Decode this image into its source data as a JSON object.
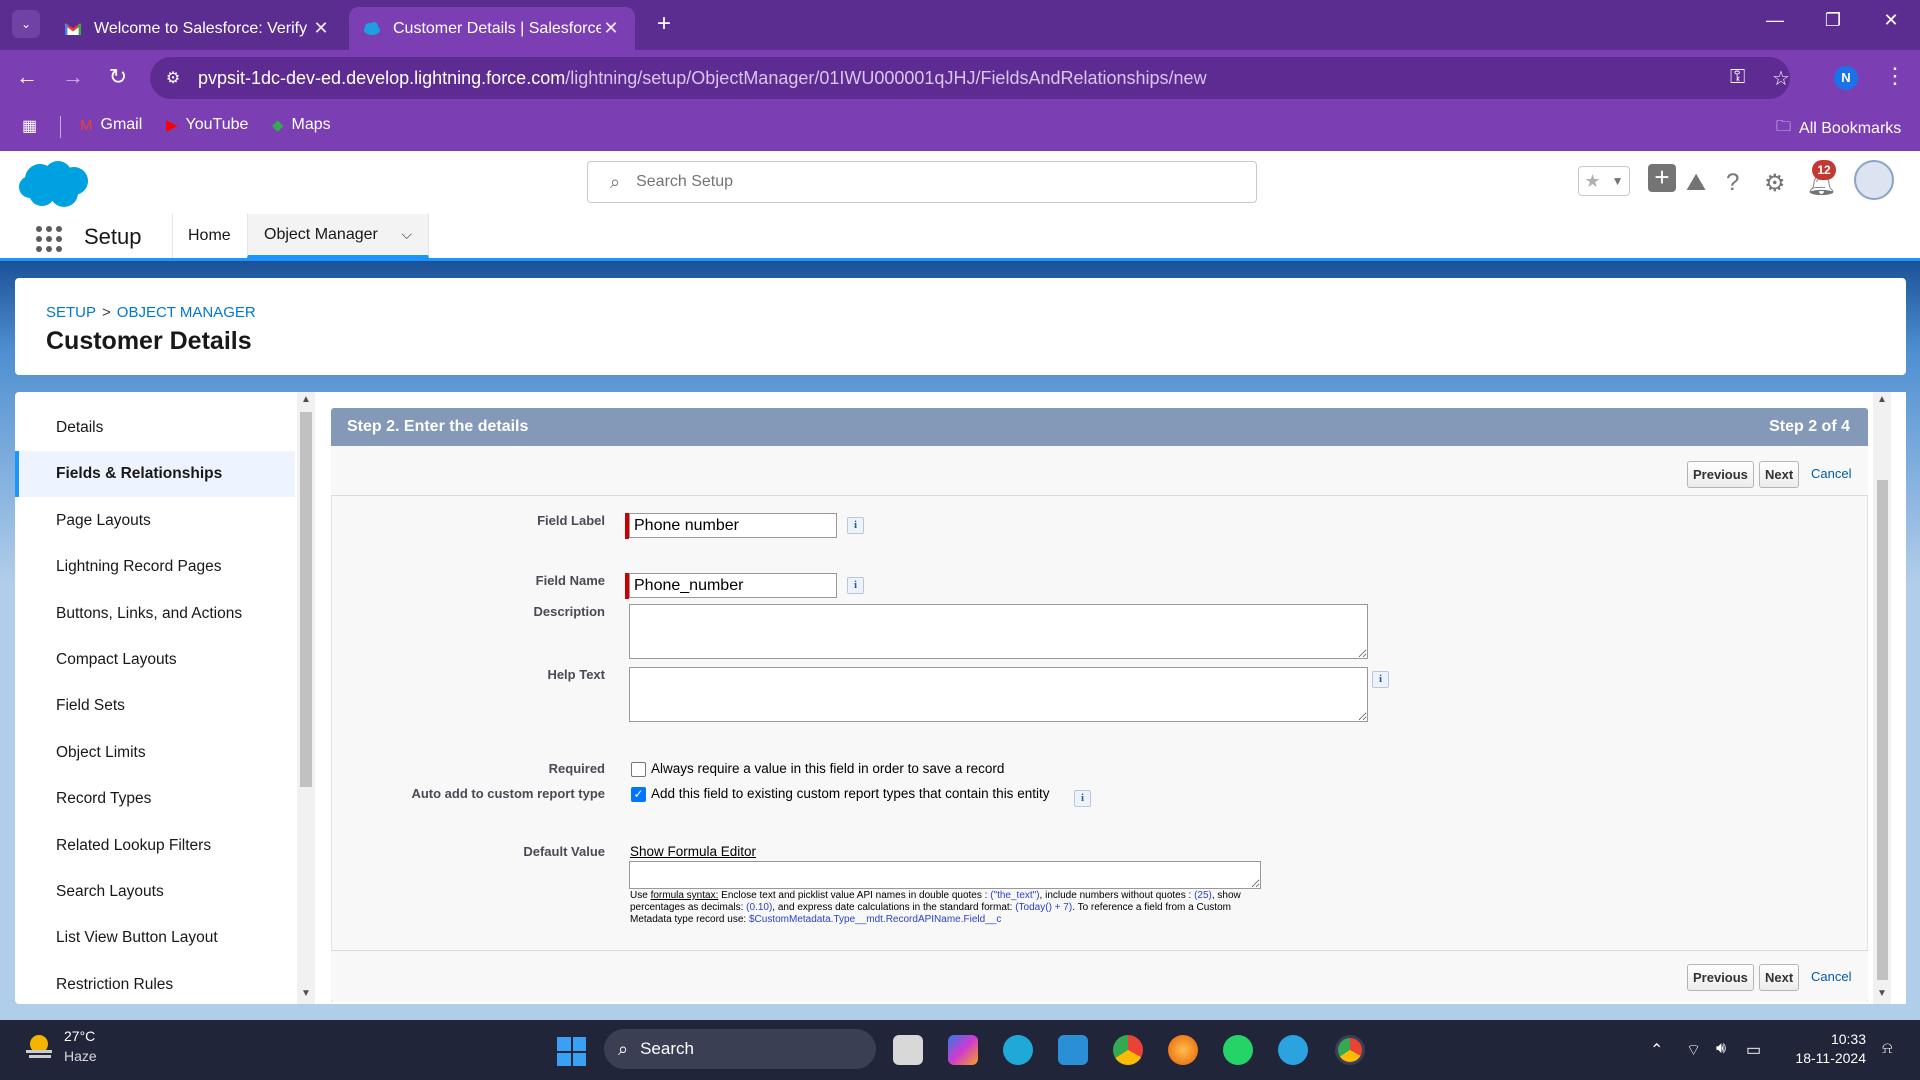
{
  "browser": {
    "tabs": [
      {
        "title": "Welcome to Salesforce: Verify y",
        "close": "✕"
      },
      {
        "title": "Customer Details | Salesforce",
        "close": "✕"
      }
    ],
    "new_tab": "+",
    "url_host": "pvpsit-1dc-dev-ed.develop.lightning.force.com",
    "url_path": "/lightning/setup/ObjectManager/01IWU000001qJHJ/FieldsAndRelationships/new",
    "profile_initial": "N",
    "bookmarks": [
      "Gmail",
      "YouTube",
      "Maps"
    ],
    "all_bookmarks": "All Bookmarks"
  },
  "sf_header": {
    "search_placeholder": "Search Setup",
    "notification_count": "12"
  },
  "sf_nav": {
    "app_name": "Setup",
    "tabs": [
      "Home",
      "Object Manager"
    ]
  },
  "page": {
    "breadcrumb": [
      "SETUP",
      "OBJECT MANAGER"
    ],
    "breadcrumb_sep": ">",
    "title": "Customer Details"
  },
  "sidebar": {
    "items": [
      {
        "label": "Details"
      },
      {
        "label": "Fields & Relationships"
      },
      {
        "label": "Page Layouts"
      },
      {
        "label": "Lightning Record Pages"
      },
      {
        "label": "Buttons, Links, and Actions"
      },
      {
        "label": "Compact Layouts"
      },
      {
        "label": "Field Sets"
      },
      {
        "label": "Object Limits"
      },
      {
        "label": "Record Types"
      },
      {
        "label": "Related Lookup Filters"
      },
      {
        "label": "Search Layouts"
      },
      {
        "label": "List View Button Layout"
      },
      {
        "label": "Restriction Rules"
      }
    ],
    "active_index": 1
  },
  "step": {
    "title": "Step 2. Enter the details",
    "progress": "Step 2 of 4"
  },
  "buttons": {
    "previous": "Previous",
    "next": "Next",
    "cancel": "Cancel"
  },
  "form": {
    "field_label": {
      "label": "Field Label",
      "value": "Phone number"
    },
    "field_name": {
      "label": "Field Name",
      "value": "Phone_number"
    },
    "description": {
      "label": "Description",
      "value": ""
    },
    "help_text": {
      "label": "Help Text",
      "value": ""
    },
    "required": {
      "label": "Required",
      "checked": false,
      "text": "Always require a value in this field in order to save a record"
    },
    "auto_add": {
      "label": "Auto add to custom report type",
      "checked": true,
      "text": "Add this field to existing custom report types that contain this entity"
    },
    "default_value": {
      "label": "Default Value",
      "link": "Show Formula Editor",
      "help": {
        "use": "Use ",
        "syntax": "formula syntax:",
        "p1": " Enclose text and picklist value API names in double quotes : ",
        "ex1": "(\"the_text\")",
        "p2": ", include numbers without quotes : ",
        "ex2": "(25)",
        "p3": ", show percentages as decimals: ",
        "ex3": "(0.10)",
        "p4": ", and express date calculations in the standard format: ",
        "ex4": "(Today() + 7)",
        "p5": ". To reference a field from a Custom Metadata type record use: ",
        "ex5": "$CustomMetadata.Type__mdt.RecordAPIName.Field__c"
      }
    },
    "info_glyph": "i"
  },
  "taskbar": {
    "weather_temp": "27°C",
    "weather_cond": "Haze",
    "search": "Search",
    "time": "10:33",
    "date": "18-11-2024"
  }
}
